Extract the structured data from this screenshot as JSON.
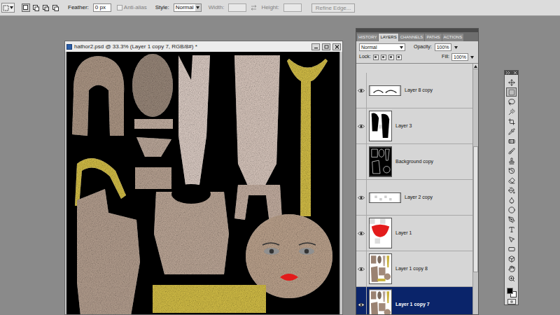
{
  "options_bar": {
    "feather_label": "Feather:",
    "feather_value": "0 px",
    "anti_alias": {
      "label": "Anti-alias",
      "checked": false,
      "disabled": true
    },
    "style_label": "Style:",
    "style_value": "Normal",
    "width_label": "Width:",
    "height_label": "Height:",
    "refine_button": {
      "label": "Refine Edge...",
      "disabled": true
    }
  },
  "document": {
    "title": "hathor2.psd @ 33.3% (Layer 1 copy 7, RGB/8#) *"
  },
  "layers_panel": {
    "tabs": [
      {
        "label": "HISTORY",
        "selected": false
      },
      {
        "label": "LAYERS",
        "selected": true
      },
      {
        "label": "CHANNELS",
        "selected": false
      },
      {
        "label": "PATHS",
        "selected": false
      },
      {
        "label": "ACTIONS",
        "selected": false
      }
    ],
    "blend_mode": "Normal",
    "opacity_label": "Opacity:",
    "opacity": "100%",
    "lock_label": "Lock:",
    "fill_label": "Fill:",
    "fill": "100%",
    "layers": [
      {
        "name": "Layer 8 copy",
        "visible": true,
        "selected": false,
        "kind": "strip"
      },
      {
        "name": "Layer 3",
        "visible": true,
        "selected": false,
        "kind": "mask"
      },
      {
        "name": "Background copy",
        "visible": false,
        "selected": false,
        "kind": "outline"
      },
      {
        "name": "Layer 2 copy",
        "visible": true,
        "selected": false,
        "kind": "strip-light"
      },
      {
        "name": "Layer 1",
        "visible": true,
        "selected": false,
        "kind": "red"
      },
      {
        "name": "Layer 1 copy 8",
        "visible": true,
        "selected": false,
        "kind": "texture"
      },
      {
        "name": "Layer 1 copy 7",
        "visible": true,
        "selected": true,
        "kind": "texture"
      }
    ]
  },
  "toolbox": {
    "tools": [
      {
        "selected": false
      },
      {
        "selected": true
      },
      {
        "selected": false
      },
      {
        "selected": false
      },
      {
        "selected": false
      },
      {
        "selected": false
      },
      {
        "selected": false
      },
      {
        "selected": false
      },
      {
        "selected": false
      },
      {
        "selected": false
      },
      {
        "selected": false
      },
      {
        "selected": false
      },
      {
        "selected": false
      },
      {
        "selected": false
      },
      {
        "selected": false
      },
      {
        "selected": false
      },
      {
        "selected": false
      },
      {
        "selected": false
      },
      {
        "selected": false
      },
      {
        "selected": false
      },
      {
        "selected": false
      }
    ],
    "foreground": "#000000",
    "background": "#ffffff"
  }
}
